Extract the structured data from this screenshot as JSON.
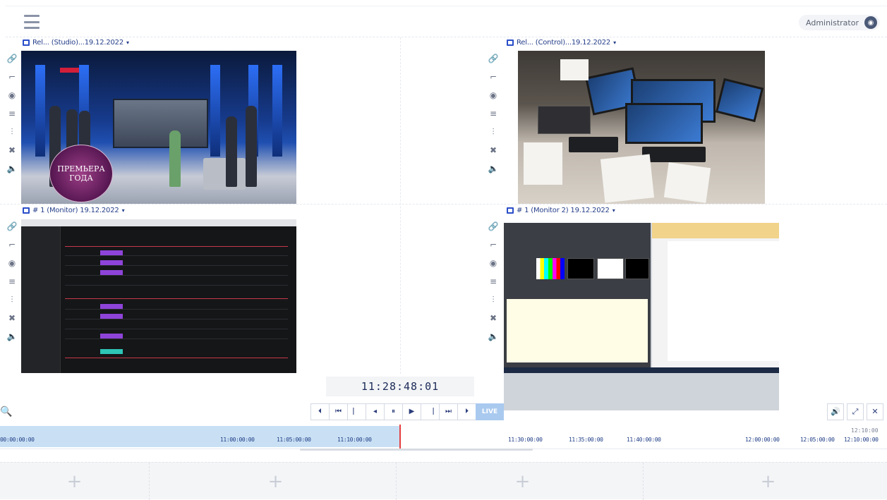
{
  "header": {
    "menu_icon": "hamburger-icon",
    "user_name": "Administrator",
    "user_icon": "account-icon"
  },
  "panels": [
    {
      "title": "Rel... (Studio)...19.12.2022",
      "caret": "▾",
      "kind": "studio",
      "logo_text": "ПРЕМЬЕРА ГОДА"
    },
    {
      "title": "Rel... (Control)...19.12.2022",
      "caret": "▾",
      "kind": "control"
    },
    {
      "title": "# 1 (Monitor) 19.12.2022",
      "caret": "▾",
      "kind": "darkapp"
    },
    {
      "title": "# 1 (Monitor 2) 19.12.2022",
      "caret": "▾",
      "kind": "autoapp"
    }
  ],
  "panel_tools": [
    {
      "icon": "link-icon",
      "glyph": "🔗"
    },
    {
      "icon": "crop-icon",
      "glyph": "⌐"
    },
    {
      "icon": "view-icon",
      "glyph": "◉"
    },
    {
      "icon": "list-icon",
      "glyph": "≡"
    },
    {
      "icon": "level-icon",
      "glyph": "⫶"
    },
    {
      "icon": "close-icon",
      "glyph": "✖"
    },
    {
      "icon": "audio-icon",
      "glyph": "🔈"
    }
  ],
  "timecode": "11:28:48:01",
  "transport": [
    {
      "name": "prev-clip-button",
      "glyph": "⏴"
    },
    {
      "name": "rewind-button",
      "glyph": "⏮"
    },
    {
      "name": "step-back-button",
      "glyph": "⎸"
    },
    {
      "name": "frame-back-button",
      "glyph": "◂"
    },
    {
      "name": "pause-button",
      "glyph": "⏸"
    },
    {
      "name": "play-button",
      "glyph": "▶"
    },
    {
      "name": "step-forward-button",
      "glyph": "⎹"
    },
    {
      "name": "fast-forward-button",
      "glyph": "⏭"
    },
    {
      "name": "next-clip-button",
      "glyph": "⏵"
    }
  ],
  "live_label": "LIVE",
  "right_controls": [
    {
      "name": "volume-button",
      "glyph": "🔊"
    },
    {
      "name": "fullscreen-button",
      "glyph": "⤢"
    },
    {
      "name": "close-button",
      "glyph": "✕"
    }
  ],
  "timeline": {
    "labels": [
      "00:00:00:00",
      "11:00:00:00",
      "11:05:00:00",
      "11:10:00:00",
      "11:30:00:00",
      "11:35:00:00",
      "11:40:00:00",
      "12:00:00:00",
      "12:05:00:00",
      "12:10:00:00"
    ],
    "top_label": "12:10:00",
    "progress": 0.452
  },
  "add_slots": [
    "+",
    "+",
    "+",
    "+"
  ]
}
